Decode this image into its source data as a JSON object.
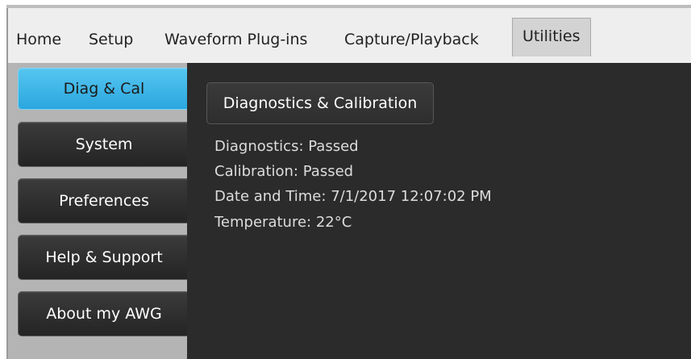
{
  "menu": {
    "tabs": [
      {
        "label": "Home"
      },
      {
        "label": "Setup"
      },
      {
        "label": "Waveform Plug-ins"
      },
      {
        "label": "Capture/Playback"
      },
      {
        "label": "Utilities",
        "active": true
      }
    ]
  },
  "sidebar": {
    "items": [
      {
        "label": "Diag & Cal",
        "active": true
      },
      {
        "label": "System"
      },
      {
        "label": "Preferences"
      },
      {
        "label": "Help & Support"
      },
      {
        "label": "About my AWG"
      }
    ]
  },
  "main": {
    "header_button": "Diagnostics & Calibration",
    "status": [
      {
        "label": "Diagnostics:",
        "value": "Passed"
      },
      {
        "label": "Calibration:",
        "value": "Passed"
      },
      {
        "label": "Date and Time:",
        "value": "7/1/2017 12:07:02 PM"
      },
      {
        "label": "Temperature:",
        "value": "22°C"
      }
    ]
  },
  "colors": {
    "accent": "#2aa6df",
    "panel": "#2b2b2b",
    "sidebar": "#b4b4b4",
    "menubar": "#eeeeee"
  }
}
